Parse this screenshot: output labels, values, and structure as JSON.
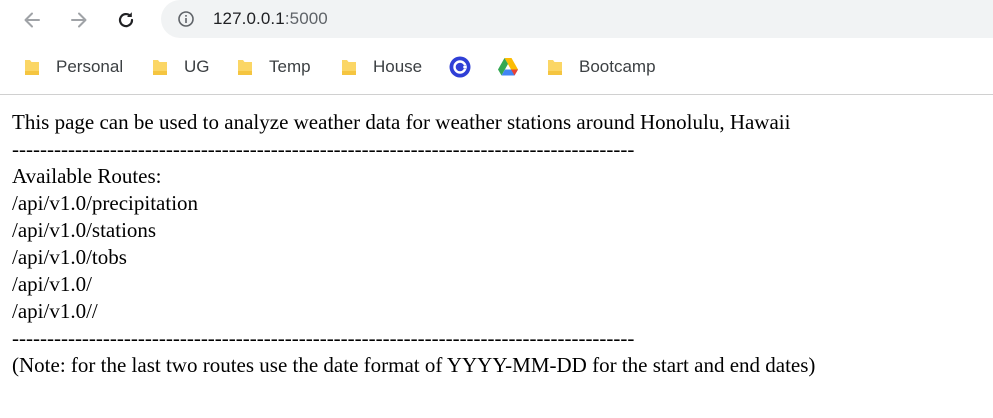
{
  "browser": {
    "url_host": "127.0.0.1",
    "url_port": ":5000",
    "bookmarks": [
      {
        "label": "Personal",
        "icon": "folder-icon"
      },
      {
        "label": "UG",
        "icon": "folder-icon"
      },
      {
        "label": "Temp",
        "icon": "folder-icon"
      },
      {
        "label": "House",
        "icon": "folder-icon"
      },
      {
        "label": "",
        "icon": "app-icon"
      },
      {
        "label": "",
        "icon": "google-drive-icon"
      },
      {
        "label": "Bootcamp",
        "icon": "folder-icon"
      }
    ],
    "accent_folder_color": "#fbd665"
  },
  "page": {
    "intro": "This page can be used to analyze weather data for weather stations around Honolulu, Hawaii",
    "separator_top": "-----------------------------------------------------------------------------------------",
    "routes_heading": "Available Routes:",
    "routes": [
      "/api/v1.0/precipitation",
      "/api/v1.0/stations",
      "/api/v1.0/tobs",
      "/api/v1.0/",
      "/api/v1.0//"
    ],
    "separator_bottom": "-----------------------------------------------------------------------------------------",
    "note": "(Note: for the last two routes use the date format of YYYY-MM-DD for the start and end dates)"
  }
}
